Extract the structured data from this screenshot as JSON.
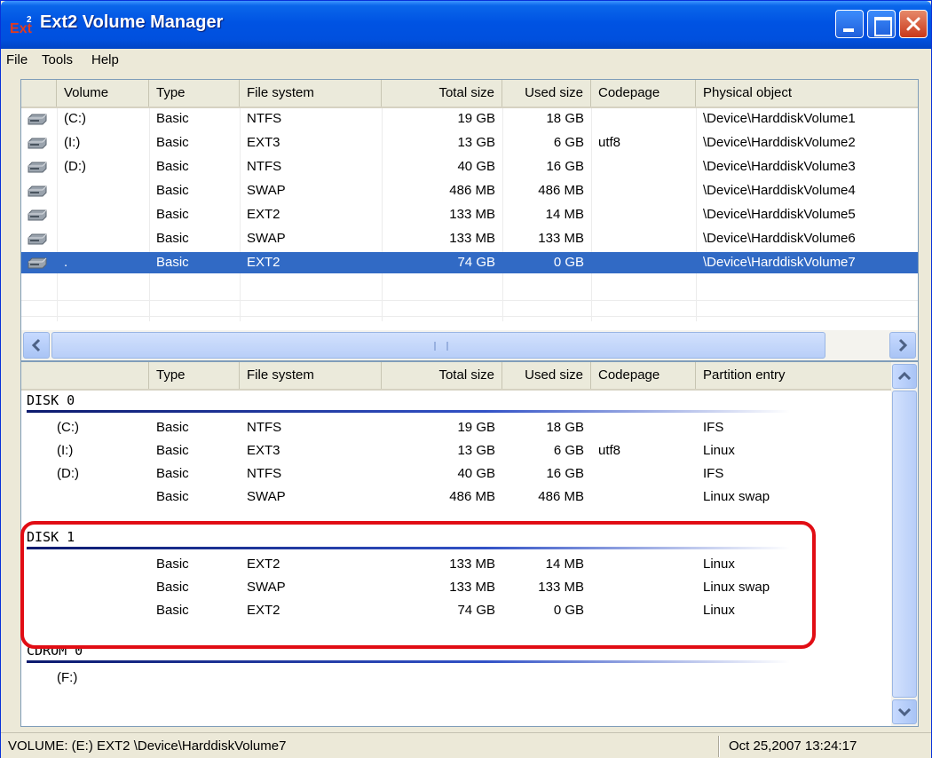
{
  "window": {
    "title": "Ext2 Volume Manager"
  },
  "menu": [
    "File",
    "Tools",
    "Help"
  ],
  "volumes": {
    "columns": [
      "Volume",
      "Type",
      "File system",
      "Total size",
      "Used size",
      "Codepage",
      "Physical object"
    ],
    "rows": [
      {
        "volume": "(C:)",
        "type": "Basic",
        "fs": "NTFS",
        "total": "19 GB",
        "used": "18 GB",
        "codepage": "",
        "object": "\\Device\\HarddiskVolume1"
      },
      {
        "volume": "(I:)",
        "type": "Basic",
        "fs": "EXT3",
        "total": "13 GB",
        "used": "6 GB",
        "codepage": "utf8",
        "object": "\\Device\\HarddiskVolume2"
      },
      {
        "volume": "(D:)",
        "type": "Basic",
        "fs": "NTFS",
        "total": "40 GB",
        "used": "16 GB",
        "codepage": "",
        "object": "\\Device\\HarddiskVolume3"
      },
      {
        "volume": "",
        "type": "Basic",
        "fs": "SWAP",
        "total": "486 MB",
        "used": "486 MB",
        "codepage": "",
        "object": "\\Device\\HarddiskVolume4"
      },
      {
        "volume": "",
        "type": "Basic",
        "fs": "EXT2",
        "total": "133 MB",
        "used": "14 MB",
        "codepage": "",
        "object": "\\Device\\HarddiskVolume5"
      },
      {
        "volume": "",
        "type": "Basic",
        "fs": "SWAP",
        "total": "133 MB",
        "used": "133 MB",
        "codepage": "",
        "object": "\\Device\\HarddiskVolume6"
      },
      {
        "volume": ".",
        "type": "Basic",
        "fs": "EXT2",
        "total": "74 GB",
        "used": "0 GB",
        "codepage": "",
        "object": "\\Device\\HarddiskVolume7",
        "selected": true
      }
    ]
  },
  "disks": {
    "columns": [
      "",
      "Type",
      "File system",
      "Total size",
      "Used size",
      "Codepage",
      "Partition entry"
    ],
    "groups": [
      {
        "name": "DISK 0",
        "rows": [
          {
            "volume": "(C:)",
            "type": "Basic",
            "fs": "NTFS",
            "total": "19 GB",
            "used": "18 GB",
            "codepage": "",
            "entry": "IFS"
          },
          {
            "volume": "(I:)",
            "type": "Basic",
            "fs": "EXT3",
            "total": "13 GB",
            "used": "6 GB",
            "codepage": "utf8",
            "entry": "Linux"
          },
          {
            "volume": "(D:)",
            "type": "Basic",
            "fs": "NTFS",
            "total": "40 GB",
            "used": "16 GB",
            "codepage": "",
            "entry": "IFS"
          },
          {
            "volume": "",
            "type": "Basic",
            "fs": "SWAP",
            "total": "486 MB",
            "used": "486 MB",
            "codepage": "",
            "entry": "Linux swap"
          }
        ]
      },
      {
        "name": "DISK 1",
        "rows": [
          {
            "volume": "",
            "type": "Basic",
            "fs": "EXT2",
            "total": "133 MB",
            "used": "14 MB",
            "codepage": "",
            "entry": "Linux"
          },
          {
            "volume": "",
            "type": "Basic",
            "fs": "SWAP",
            "total": "133 MB",
            "used": "133 MB",
            "codepage": "",
            "entry": "Linux swap"
          },
          {
            "volume": "",
            "type": "Basic",
            "fs": "EXT2",
            "total": "74 GB",
            "used": "0 GB",
            "codepage": "",
            "entry": "Linux"
          }
        ]
      },
      {
        "name": "CDROM 0",
        "rows": [
          {
            "volume": "(F:)",
            "type": "",
            "fs": "",
            "total": "",
            "used": "",
            "codepage": "",
            "entry": ""
          }
        ]
      }
    ]
  },
  "status": {
    "left": "VOLUME: (E:) EXT2 \\Device\\HarddiskVolume7",
    "right": "Oct 25,2007 13:24:17"
  },
  "colors": {
    "title_bar": "#0053e3",
    "selection": "#316ac5",
    "highlight_border": "#e10d14"
  }
}
